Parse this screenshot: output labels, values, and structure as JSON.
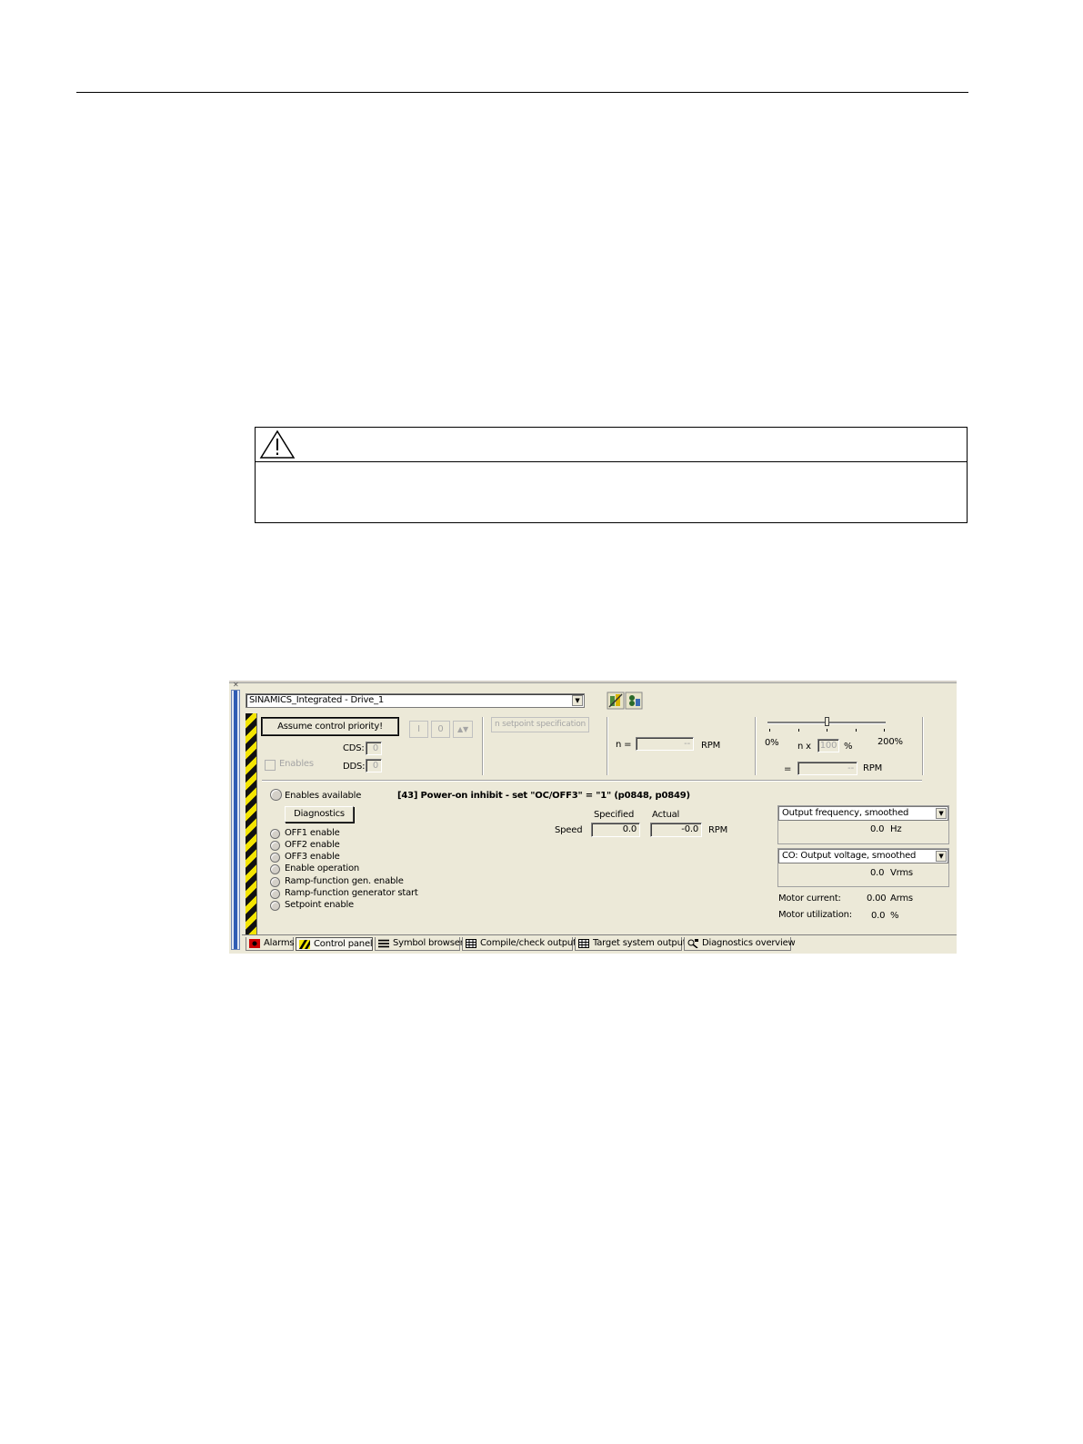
{
  "panel": {
    "drive_select": "SINAMICS_Integrated - Drive_1",
    "assume_control_button": "Assume control priority!",
    "enables_checkbox_label": "Enables",
    "cds_label": "CDS:",
    "cds_value": "0",
    "dds_label": "DDS:",
    "dds_value": "0",
    "on_button": "I",
    "off_button": "0",
    "jog_button": "▲▼",
    "setpoint_spec_button": "n setpoint specification",
    "n_label": "n =",
    "n_value": "--",
    "n_unit": "RPM",
    "slider_min": "0%",
    "slider_max": "200%",
    "n_x_label": "n x",
    "percent_value": "100",
    "percent_unit": "%",
    "eq_label": "=",
    "eq_value": "--",
    "eq_unit": "RPM",
    "enables_available": "Enables available",
    "diagnostics_button": "Diagnostics",
    "status_message": "[43] Power-on inhibit - set \"OC/OFF3\" = \"1\" (p0848, p0849)",
    "enable_items": [
      "OFF1 enable",
      "OFF2 enable",
      "OFF3 enable",
      "Enable operation",
      "Ramp-function gen. enable",
      "Ramp-function generator start",
      "Setpoint enable"
    ],
    "specified_label": "Specified",
    "actual_label": "Actual",
    "speed_label": "Speed",
    "speed_specified": "0.0",
    "speed_actual": "-0.0",
    "speed_unit": "RPM",
    "monitor1_select": "Output frequency, smoothed",
    "monitor1_value": "0.0",
    "monitor1_unit": "Hz",
    "monitor2_select": "CO: Output voltage, smoothed",
    "monitor2_value": "0.0",
    "monitor2_unit": "Vrms",
    "motor_current_label": "Motor current:",
    "motor_current_value": "0.00",
    "motor_current_unit": "Arms",
    "motor_util_label": "Motor utilization:",
    "motor_util_value": "0.0",
    "motor_util_unit": "%"
  },
  "tabs": [
    {
      "label": "Alarms",
      "icon": "alarm-icon",
      "color": "#cc0000"
    },
    {
      "label": "Control panel",
      "icon": "hazard-icon",
      "color": "#f3e400"
    },
    {
      "label": "Symbol browser",
      "icon": "list-icon",
      "color": "#000000"
    },
    {
      "label": "Compile/check output",
      "icon": "grid-icon",
      "color": "#000000"
    },
    {
      "label": "Target system output",
      "icon": "grid-icon",
      "color": "#000000"
    },
    {
      "label": "Diagnostics overview",
      "icon": "diagnostics-icon",
      "color": "#000000"
    }
  ],
  "colors": {
    "panel_bg": "#ece9d8",
    "hazard_yellow": "#f3e400",
    "hazard_black": "#111111"
  }
}
